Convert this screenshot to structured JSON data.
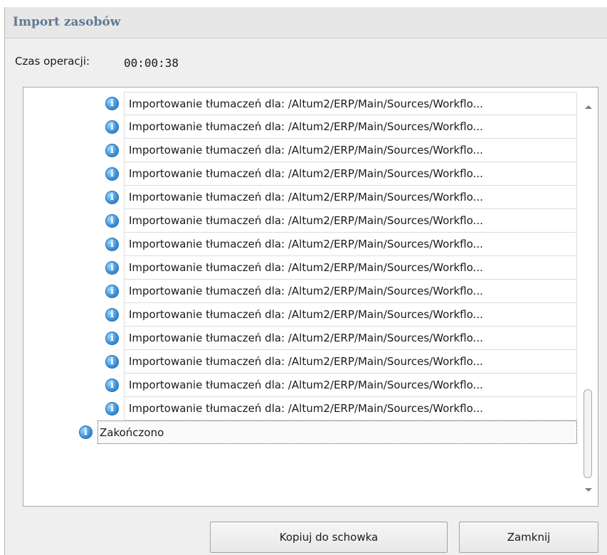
{
  "window": {
    "title": "Import zasobów"
  },
  "operation_time": {
    "label": "Czas operacji:",
    "value": "00:00:38"
  },
  "log": {
    "entries": [
      "Importowanie tłumaczeń dla: /Altum2/ERP/Main/Sources/Workflo...",
      "Importowanie tłumaczeń dla: /Altum2/ERP/Main/Sources/Workflo...",
      "Importowanie tłumaczeń dla: /Altum2/ERP/Main/Sources/Workflo...",
      "Importowanie tłumaczeń dla: /Altum2/ERP/Main/Sources/Workflo...",
      "Importowanie tłumaczeń dla: /Altum2/ERP/Main/Sources/Workflo...",
      "Importowanie tłumaczeń dla: /Altum2/ERP/Main/Sources/Workflo...",
      "Importowanie tłumaczeń dla: /Altum2/ERP/Main/Sources/Workflo...",
      "Importowanie tłumaczeń dla: /Altum2/ERP/Main/Sources/Workflo...",
      "Importowanie tłumaczeń dla: /Altum2/ERP/Main/Sources/Workflo...",
      "Importowanie tłumaczeń dla: /Altum2/ERP/Main/Sources/Workflo...",
      "Importowanie tłumaczeń dla: /Altum2/ERP/Main/Sources/Workflo...",
      "Importowanie tłumaczeń dla: /Altum2/ERP/Main/Sources/Workflo...",
      "Importowanie tłumaczeń dla: /Altum2/ERP/Main/Sources/Workflo...",
      "Importowanie tłumaczeń dla: /Altum2/ERP/Main/Sources/Workflo..."
    ],
    "final_entry": "Zakończono",
    "icon": "info-icon"
  },
  "buttons": {
    "copy_label": "Kopiuj do schowka",
    "close_label": "Zamknij"
  },
  "colors": {
    "title": "#5b7a95",
    "info_icon": "#3b8fd6"
  }
}
